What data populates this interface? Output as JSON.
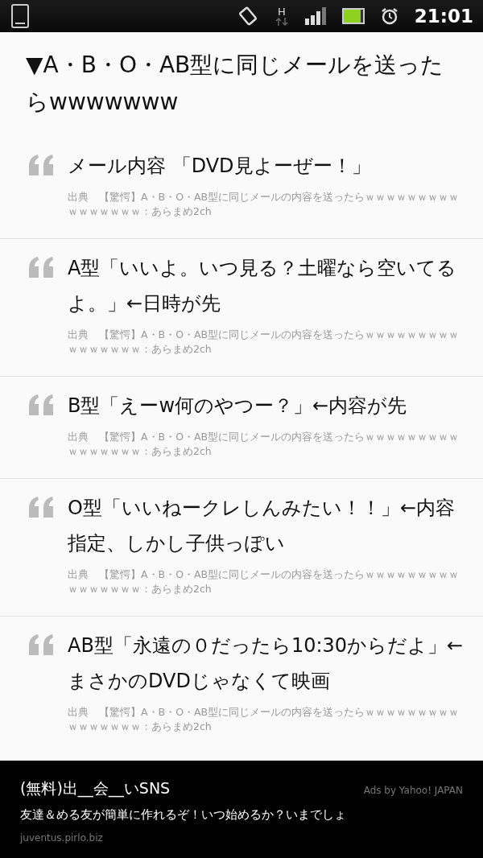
{
  "status_bar": {
    "network": "H",
    "time": "21:01"
  },
  "title": "▼A・B・O・AB型に同じメールを送ったらwwwwwww",
  "quotes": [
    {
      "text": "メール内容 「DVD見よーぜー！」",
      "source": "出典　【驚愕】A・B・O・AB型に同じメールの内容を送ったらｗｗｗｗｗｗｗｗｗｗｗｗｗｗｗｗ：あらまめ2ch"
    },
    {
      "text": "A型「いいよ。いつ見る？土曜なら空いてるよ。」←日時が先",
      "source": "出典　【驚愕】A・B・O・AB型に同じメールの内容を送ったらｗｗｗｗｗｗｗｗｗｗｗｗｗｗｗｗ：あらまめ2ch"
    },
    {
      "text": "B型「えーw何のやつー？」←内容が先",
      "source": "出典　【驚愕】A・B・O・AB型に同じメールの内容を送ったらｗｗｗｗｗｗｗｗｗｗｗｗｗｗｗｗ：あらまめ2ch"
    },
    {
      "text": "O型「いいねークレしんみたい！！」←内容指定、しかし子供っぽい",
      "source": "出典　【驚愕】A・B・O・AB型に同じメールの内容を送ったらｗｗｗｗｗｗｗｗｗｗｗｗｗｗｗｗ：あらまめ2ch"
    },
    {
      "text": "AB型「永遠の０だったら10:30からだよ」←まさかのDVDじゃなくて映画",
      "source": "出典　【驚愕】A・B・O・AB型に同じメールの内容を送ったらｗｗｗｗｗｗｗｗｗｗｗｗｗｗｗｗ：あらまめ2ch"
    }
  ],
  "ad": {
    "title": "(無料)出__会__いSNS",
    "credit": "Ads by Yahoo! JAPAN",
    "text": "友達＆める友が簡単に作れるぞ！いつ始めるか？いまでしょ",
    "url": "juventus.pirlo.biz"
  }
}
